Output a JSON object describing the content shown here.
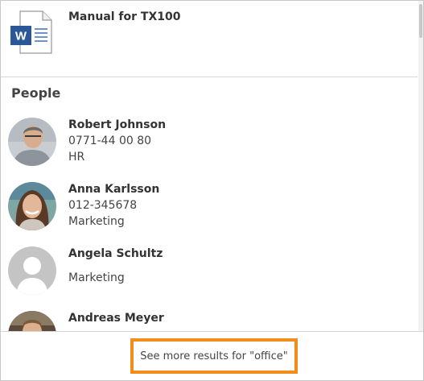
{
  "document": {
    "title": "Manual for TX100",
    "icon": "word-document-icon",
    "icon_letter": "W"
  },
  "people_section": {
    "title": "People",
    "people": [
      {
        "name": "Robert Johnson",
        "phone": "0771-44 00 80",
        "department": "HR"
      },
      {
        "name": "Anna Karlsson",
        "phone": "012-345678",
        "department": "Marketing"
      },
      {
        "name": "Angela Schultz",
        "phone": "",
        "department": "Marketing"
      },
      {
        "name": "Andreas Meyer",
        "phone": "",
        "department": ""
      }
    ]
  },
  "footer": {
    "see_more_label": "See more results for \"office\""
  },
  "colors": {
    "accent": "#f28c1a",
    "word_blue": "#2b5797"
  }
}
